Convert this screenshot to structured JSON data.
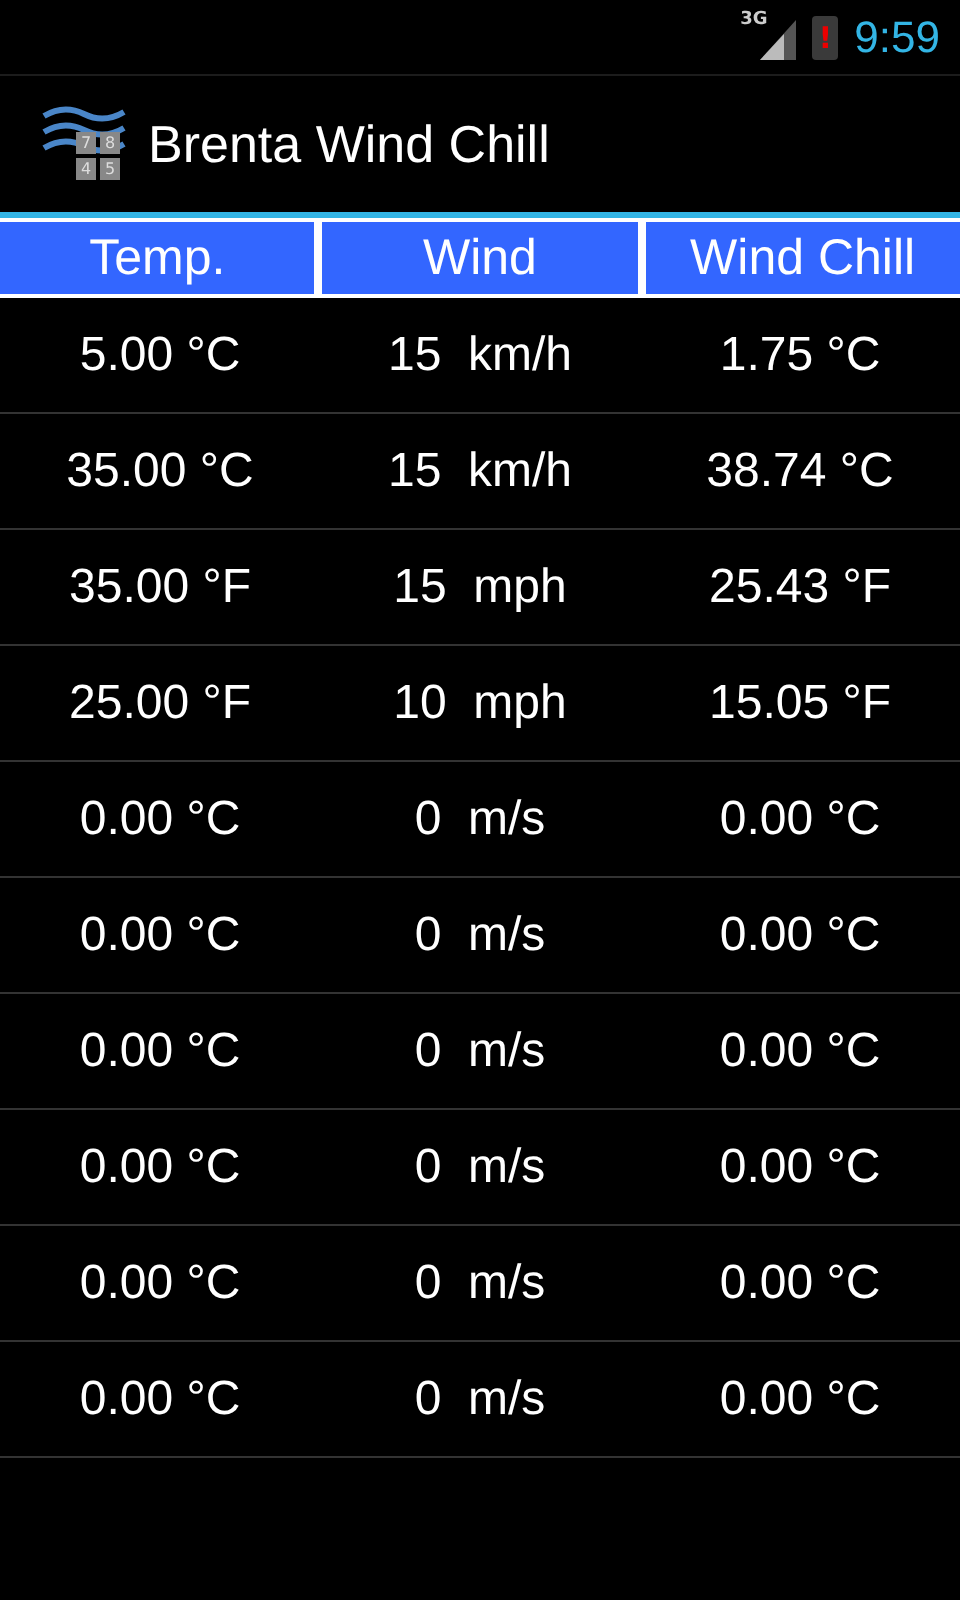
{
  "status_bar": {
    "network": "3G",
    "battery_alert": "!",
    "time": "9:59"
  },
  "app_bar": {
    "icon_keys": [
      "7",
      "8",
      "4",
      "5"
    ],
    "title": "Brenta Wind Chill"
  },
  "table": {
    "columns": [
      "Temp.",
      "Wind",
      "Wind Chill"
    ],
    "rows": [
      [
        "5.00 °C",
        "15  km/h",
        "1.75 °C"
      ],
      [
        "35.00 °C",
        "15  km/h",
        "38.74 °C"
      ],
      [
        "35.00 °F",
        "15  mph",
        "25.43 °F"
      ],
      [
        "25.00 °F",
        "10  mph",
        "15.05 °F"
      ],
      [
        "0.00 °C",
        "0  m/s",
        "0.00 °C"
      ],
      [
        "0.00 °C",
        "0  m/s",
        "0.00 °C"
      ],
      [
        "0.00 °C",
        "0  m/s",
        "0.00 °C"
      ],
      [
        "0.00 °C",
        "0  m/s",
        "0.00 °C"
      ],
      [
        "0.00 °C",
        "0  m/s",
        "0.00 °C"
      ],
      [
        "0.00 °C",
        "0  m/s",
        "0.00 °C"
      ]
    ]
  }
}
